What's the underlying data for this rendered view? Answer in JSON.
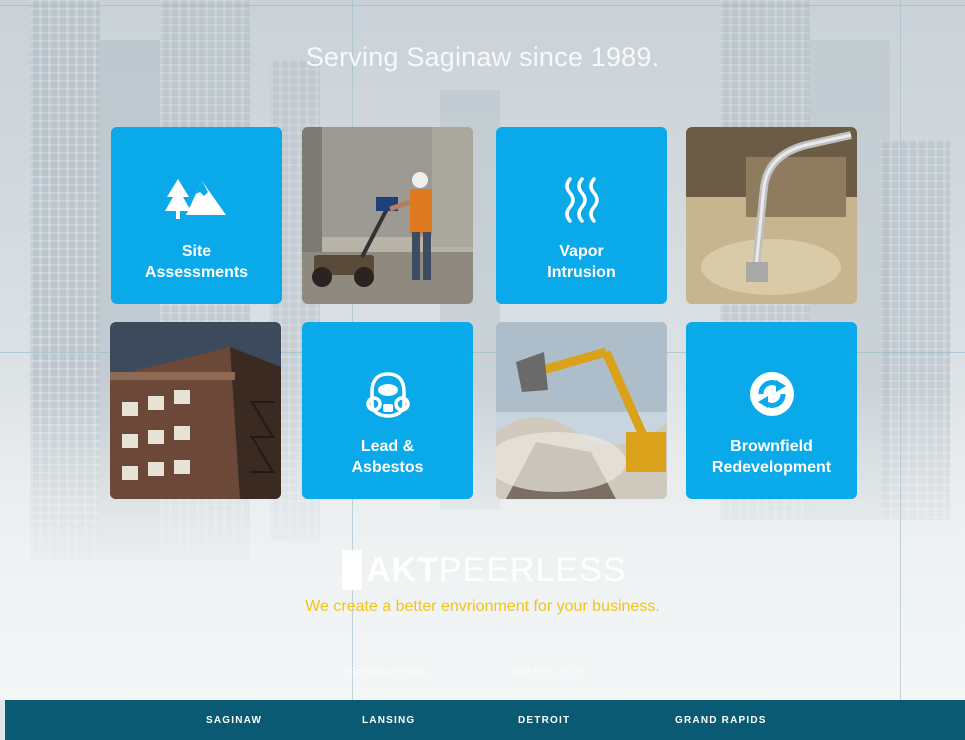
{
  "header": {
    "tagline": "Serving Saginaw since 1989."
  },
  "services": {
    "site": {
      "label": "Site\nAssessments",
      "icon": "trees-mountain-icon"
    },
    "vapor": {
      "label": "Vapor\nIntrusion",
      "icon": "vapor-waves-icon"
    },
    "lead": {
      "label": "Lead &\nAsbestos",
      "icon": "respirator-mask-icon"
    },
    "brownfield": {
      "label": "Brownfield\nRedevelopment",
      "icon": "recycle-arrows-icon"
    }
  },
  "brand": {
    "logo_bold": "AKT",
    "logo_light": "PEERLESS",
    "slogan": "We create a better envrionment for your business.",
    "contact_left": "Saginaw Office",
    "contact_right": "989.555.0123"
  },
  "footer": {
    "locations": [
      "SAGINAW",
      "LANSING",
      "DETROIT",
      "GRAND RAPIDS"
    ]
  },
  "colors": {
    "tile_blue": "#0aa9ea",
    "footer_bg": "#0b5a74",
    "slogan": "#f1c41b"
  }
}
